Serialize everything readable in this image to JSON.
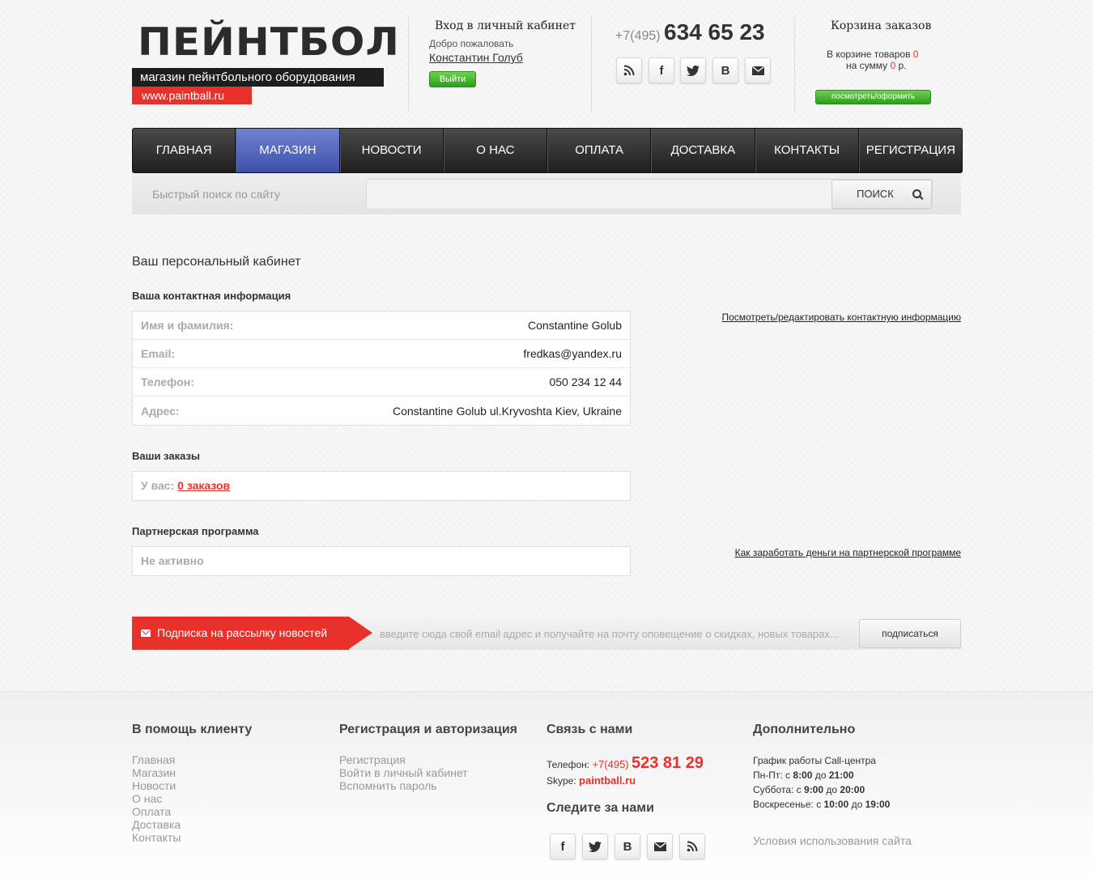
{
  "header": {
    "logo_title": "ПЕЙНТБОЛ",
    "logo_subtitle": "магазин пейнтбольного оборудования",
    "logo_url": "www.paintball.ru",
    "login": {
      "title": "Вход в личный кабинет",
      "welcome": "Добро пожаловать",
      "username": "Константин Голуб",
      "logout": "Выйти"
    },
    "phone_code": "+7(495)",
    "phone_number": "634 65 23",
    "social_icons": [
      "rss-icon",
      "facebook-icon",
      "twitter-icon",
      "vkontakte-icon",
      "email-icon"
    ],
    "cart": {
      "title": "Корзина заказов",
      "items_label": "В корзине товаров",
      "items_count": "0",
      "sum_label": "на сумму",
      "sum_value": "0",
      "currency": "р.",
      "button": "посмотреть/оформить"
    }
  },
  "nav": {
    "items": [
      "ГЛАВНАЯ",
      "МАГАЗИН",
      "НОВОСТИ",
      "О НАС",
      "ОПЛАТА",
      "ДОСТАВКА",
      "КОНТАКТЫ",
      "РЕГИСТРАЦИЯ"
    ],
    "active": "МАГАЗИН"
  },
  "search": {
    "label": "Быстрый поиск по сайту",
    "value": "",
    "button": "ПОИСК"
  },
  "main": {
    "page_title": "Ваш персональный кабинет",
    "contact": {
      "title": "Ваша контактная информация",
      "edit_link": "Посмотреть/редактировать контактную информацию",
      "rows": [
        {
          "label": "Имя и фамилия:",
          "value": "Constantine Golub"
        },
        {
          "label": "Email:",
          "value": "fredkas@yandex.ru"
        },
        {
          "label": "Телефон:",
          "value": "050 234 12 44"
        },
        {
          "label": "Адрес:",
          "value": "Constantine Golub ul.Kryvoshta Kiev, Ukraine"
        }
      ]
    },
    "orders": {
      "title": "Ваши заказы",
      "label": "У вас:",
      "link": "0 заказов"
    },
    "partner": {
      "title": "Партнерская программа",
      "status": "Не активно",
      "link": "Как заработать деньги на партнерской программе"
    }
  },
  "subscribe": {
    "title": "Подписка на рассылку новостей",
    "placeholder": "введите сюда свой email адрес и получайте на почту оповещение о скидках, новых товарах...",
    "button": "подписаться"
  },
  "footer": {
    "help": {
      "title": "В помощь клиенту",
      "links": [
        "Главная",
        "Магазин",
        "Новости",
        "О нас",
        "Оплата",
        "Доставка",
        "Контакты"
      ]
    },
    "auth": {
      "title": "Регистрация и авторизация",
      "links": [
        "Регистрация",
        "Войти в личный кабинет",
        "Вспомнить пароль"
      ]
    },
    "contact": {
      "title": "Связь с нами",
      "phone_label": "Телефон:",
      "phone_code": "+7(495)",
      "phone_number": "523 81 29",
      "skype_label": "Skype:",
      "skype_value": "paintball.ru",
      "follow_title": "Следите за нами",
      "social_icons": [
        "facebook-icon",
        "twitter-icon",
        "vkontakte-icon",
        "email-icon",
        "rss-icon"
      ]
    },
    "extra": {
      "title": "Дополнительно",
      "schedule_title": "График работы Call-центра",
      "schedule": [
        {
          "days": "Пн-Пт:",
          "from_label": "с",
          "from": "8:00",
          "to_label": "до",
          "to": "21:00"
        },
        {
          "days": "Суббота:",
          "from_label": "с",
          "from": "9:00",
          "to_label": "до",
          "to": "20:00"
        },
        {
          "days": "Воскресенье:",
          "from_label": "с",
          "from": "10:00",
          "to_label": "до",
          "to": "19:00"
        }
      ],
      "terms_link": "Условия использования сайта"
    }
  }
}
